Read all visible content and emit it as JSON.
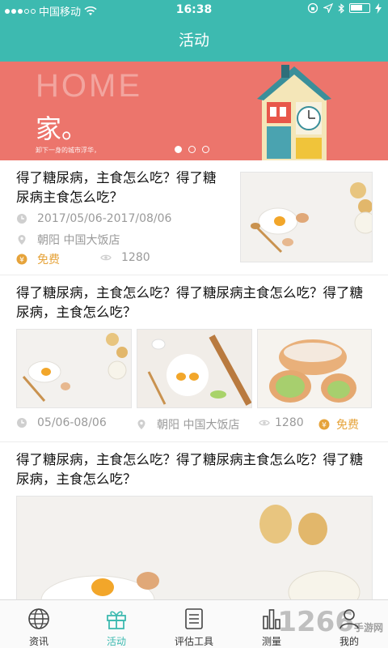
{
  "status": {
    "carrier": "中国移动",
    "time": "16:38"
  },
  "nav": {
    "title": "活动"
  },
  "banner": {
    "home_word": "HOME",
    "heading": "家。",
    "subtext": "卸下一身的城市浮华，"
  },
  "cards": [
    {
      "title": "得了糖尿病，主食怎么吃？得了糖尿病主食怎么吃？",
      "date": "2017/05/06-2017/08/06",
      "location": "朝阳 中国大饭店",
      "price": "免费",
      "views": "1280"
    },
    {
      "title": "得了糖尿病，主食怎么吃？得了糖尿病主食怎么吃？得了糖尿病，主食怎么吃？",
      "date": "05/06-08/06",
      "location": "朝阳 中国大饭店",
      "views": "1280",
      "price": "免费"
    },
    {
      "title": "得了糖尿病，主食怎么吃？得了糖尿病主食怎么吃？得了糖尿病，主食怎么吃？"
    }
  ],
  "tabs": [
    {
      "label": "资讯",
      "icon": "globe-icon"
    },
    {
      "label": "活动",
      "icon": "gift-icon"
    },
    {
      "label": "评估工具",
      "icon": "list-icon"
    },
    {
      "label": "测量",
      "icon": "bar-chart-icon"
    },
    {
      "label": "我的",
      "icon": "user-icon"
    }
  ],
  "watermark": {
    "brand": "1266",
    "site": "手游网"
  },
  "colors": {
    "primary": "#3dbab0",
    "banner": "#ec756c",
    "accent": "#e6a33a"
  }
}
